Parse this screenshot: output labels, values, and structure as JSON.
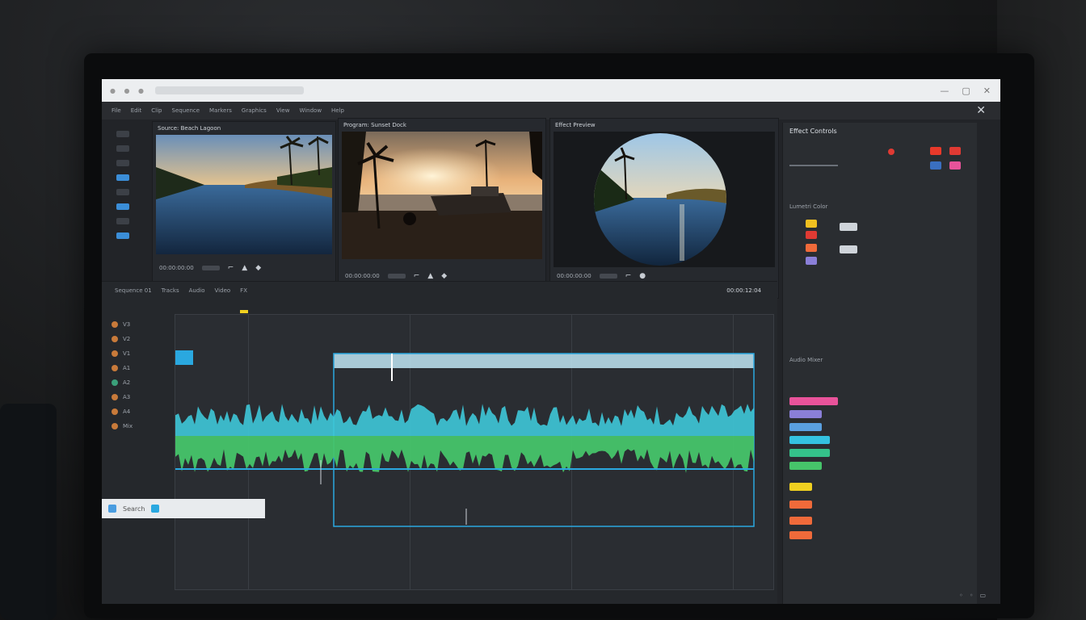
{
  "window": {
    "url": "",
    "controls": [
      "—",
      "▢",
      "✕"
    ]
  },
  "menubar": {
    "items": [
      "File",
      "Edit",
      "Clip",
      "Sequence",
      "Markers",
      "Graphics",
      "View",
      "Window",
      "Help"
    ],
    "close": "✕"
  },
  "viewers": [
    {
      "title": "Source: Beach Lagoon",
      "timecode": "00:00:00:00",
      "scene": "lagoon"
    },
    {
      "title": "Program: Sunset Dock",
      "timecode": "00:00:00:00",
      "scene": "sunset"
    },
    {
      "title": "Effect Preview",
      "timecode": "00:00:00:00",
      "scene": "fisheye"
    }
  ],
  "timeline": {
    "header": [
      "Sequence 01",
      "Tracks",
      "Audio",
      "Video",
      "FX"
    ],
    "timecode": "00:00:12:04",
    "tracks": [
      {
        "label": "V3",
        "kind": "video"
      },
      {
        "label": "V2",
        "kind": "video"
      },
      {
        "label": "V1",
        "kind": "video"
      },
      {
        "label": "A1",
        "kind": "audio"
      },
      {
        "label": "A2",
        "kind": "audio"
      },
      {
        "label": "A3",
        "kind": "audio"
      },
      {
        "label": "A4",
        "kind": "audio"
      },
      {
        "label": "Mix",
        "kind": "audio"
      }
    ]
  },
  "right_panel": {
    "title": "Effect Controls",
    "section2": "Lumetri Color",
    "section3": "Audio Mixer",
    "colors": [
      "#e8392a",
      "#e03a33",
      "#e8539a",
      "#3a6fc0",
      "#f0c020",
      "#f06a3a",
      "#34c28a",
      "#8a7fd8"
    ]
  },
  "taskbar": {
    "search": "Search"
  }
}
